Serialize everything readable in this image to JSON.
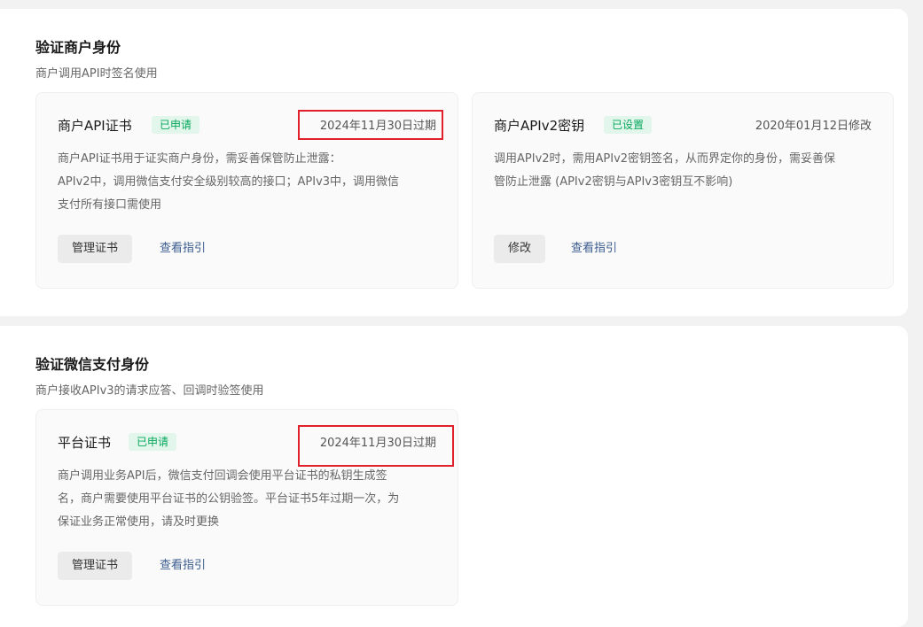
{
  "section1": {
    "title": "验证商户身份",
    "subtitle": "商户调用API时签名使用",
    "cards": [
      {
        "title": "商户API证书",
        "tag": "已申请",
        "date": "2024年11月30日过期",
        "desc_lines": [
          "商户API证书用于证实商户身份，需妥善保管防止泄露：",
          "APIv2中，调用微信支付安全级别较高的接口；APIv3中，调用微信",
          "支付所有接口需使用"
        ],
        "button": "管理证书",
        "link": "查看指引"
      },
      {
        "title": "商户APIv2密钥",
        "tag": "已设置",
        "date": "2020年01月12日修改",
        "desc_lines": [
          "调用APIv2时，需用APIv2密钥签名，从而界定你的身份，需妥善保",
          "管防止泄露 (APIv2密钥与APIv3密钥互不影响)"
        ],
        "button": "修改",
        "link": "查看指引"
      }
    ]
  },
  "section2": {
    "title": "验证微信支付身份",
    "subtitle": "商户接收APIv3的请求应答、回调时验签使用",
    "cards": [
      {
        "title": "平台证书",
        "tag": "已申请",
        "date": "2024年11月30日过期",
        "desc_lines": [
          "商户调用业务API后，微信支付回调会使用平台证书的私钥生成签",
          "名，商户需要使用平台证书的公钥验签。平台证书5年过期一次，为",
          "保证业务正常使用，请及时更换"
        ],
        "button": "管理证书",
        "link": "查看指引"
      }
    ]
  },
  "colors": {
    "tag_green": "#07a85c",
    "highlight_red": "#e0202a",
    "link_blue": "#3b5c8f"
  }
}
